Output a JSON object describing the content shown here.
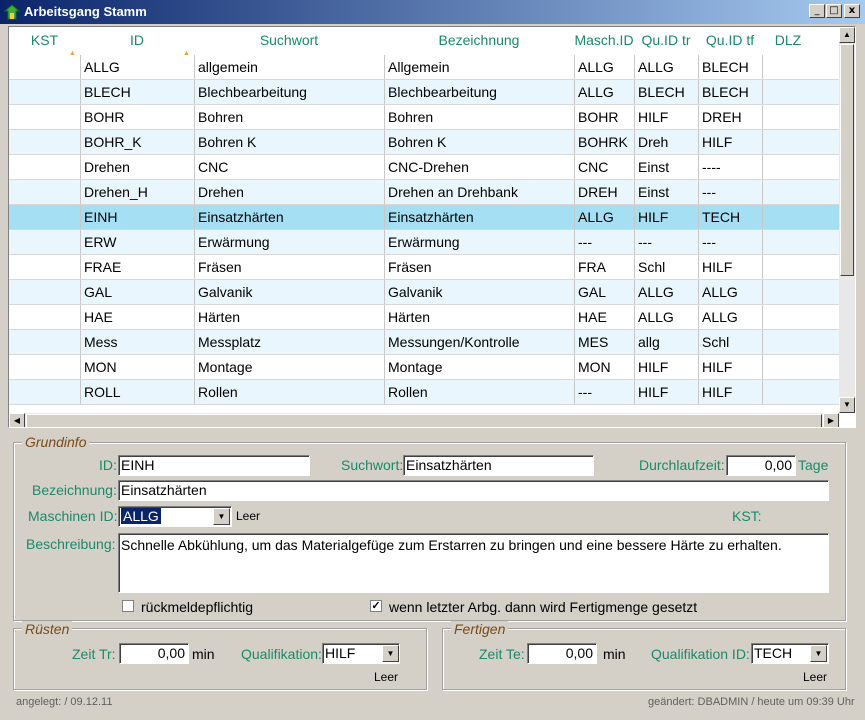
{
  "window": {
    "title": "Arbeitsgang Stamm",
    "minimize": "_",
    "maximize": "□",
    "close": "x"
  },
  "grid": {
    "columns": [
      {
        "label": "KST",
        "sorted": true
      },
      {
        "label": "ID",
        "sorted": true
      },
      {
        "label": "Suchwort",
        "sorted": false
      },
      {
        "label": "Bezeichnung",
        "sorted": false
      },
      {
        "label": "Masch.ID",
        "sorted": false
      },
      {
        "label": "Qu.ID tr",
        "sorted": false
      },
      {
        "label": "Qu.ID tf",
        "sorted": false
      },
      {
        "label": "DLZ",
        "sorted": false
      }
    ],
    "sort_glyph": "▲",
    "selected_index": 6,
    "rows": [
      [
        "",
        "ALLG",
        "allgemein",
        "Allgemein",
        "ALLG",
        "ALLG",
        "BLECH",
        ""
      ],
      [
        "",
        "BLECH",
        "Blechbearbeitung",
        "Blechbearbeitung",
        "ALLG",
        "BLECH",
        "BLECH",
        ""
      ],
      [
        "",
        "BOHR",
        "Bohren",
        "Bohren",
        "BOHR",
        "HILF",
        "DREH",
        ""
      ],
      [
        "",
        "BOHR_K",
        "Bohren K",
        "Bohren K",
        "BOHRK",
        "Dreh",
        "HILF",
        ""
      ],
      [
        "",
        "Drehen",
        "CNC",
        "CNC-Drehen",
        "CNC",
        "Einst",
        "----",
        ""
      ],
      [
        "",
        "Drehen_H",
        "Drehen",
        "Drehen an Drehbank",
        "DREH",
        "Einst",
        "---",
        ""
      ],
      [
        "",
        "EINH",
        "Einsatzhärten",
        "Einsatzhärten",
        "ALLG",
        "HILF",
        "TECH",
        ""
      ],
      [
        "",
        "ERW",
        "Erwärmung",
        "Erwärmung",
        "---",
        "---",
        "---",
        ""
      ],
      [
        "",
        "FRAE",
        "Fräsen",
        "Fräsen",
        "FRA",
        "Schl",
        "HILF",
        ""
      ],
      [
        "",
        "GAL",
        "Galvanik",
        "Galvanik",
        "GAL",
        "ALLG",
        "ALLG",
        ""
      ],
      [
        "",
        "HAE",
        "Härten",
        "Härten",
        "HAE",
        "ALLG",
        "ALLG",
        ""
      ],
      [
        "",
        "Mess",
        "Messplatz",
        "Messungen/Kontrolle",
        "MES",
        "allg",
        "Schl",
        ""
      ],
      [
        "",
        "MON",
        "Montage",
        "Montage",
        "MON",
        "HILF",
        "HILF",
        ""
      ],
      [
        "",
        "ROLL",
        "Rollen",
        "Rollen",
        "---",
        "HILF",
        "HILF",
        ""
      ]
    ]
  },
  "grundinfo": {
    "legend": "Grundinfo",
    "id_label": "ID:",
    "id_value": "EINH",
    "suchwort_label": "Suchwort:",
    "suchwort_value": "Einsatzhärten",
    "dlz_label": "Durchlaufzeit:",
    "dlz_value": "0,00",
    "dlz_unit": "Tage",
    "bez_label": "Bezeichnung:",
    "bez_value": "Einsatzhärten",
    "masch_label": "Maschinen ID:",
    "masch_value": "ALLG",
    "masch_note": "Leer",
    "kst_label": "KST:",
    "beschr_label": "Beschreibung:",
    "beschr_value": "Schnelle Abkühlung, um das Materialgefüge zum Erstarren zu bringen und eine bessere Härte zu erhalten.",
    "chk1_label": "rückmeldepflichtig",
    "chk1_checked": false,
    "chk2_label": "wenn letzter Arbg. dann wird Fertigmenge gesetzt",
    "chk2_checked": true,
    "check_glyph": "✓"
  },
  "ruesten": {
    "legend": "Rüsten",
    "zeit_label": "Zeit Tr:",
    "zeit_value": "0,00",
    "unit": "min",
    "qual_label": "Qualifikation:",
    "qual_value": "HILF",
    "note": "Leer"
  },
  "fertigen": {
    "legend": "Fertigen",
    "zeit_label": "Zeit Te:",
    "zeit_value": "0,00",
    "unit": "min",
    "qual_label": "Qualifikation ID:",
    "qual_value": "TECH",
    "note": "Leer"
  },
  "footer": {
    "created": "angelegt:  / 09.12.11",
    "changed": "geändert: DBADMIN / heute um 09:39 Uhr"
  },
  "colors": {
    "header_text": "#1a8a6a",
    "selected_row": "#a5dff3",
    "alt_row": "#eaf6fd",
    "legend_text": "#7a4a18"
  }
}
